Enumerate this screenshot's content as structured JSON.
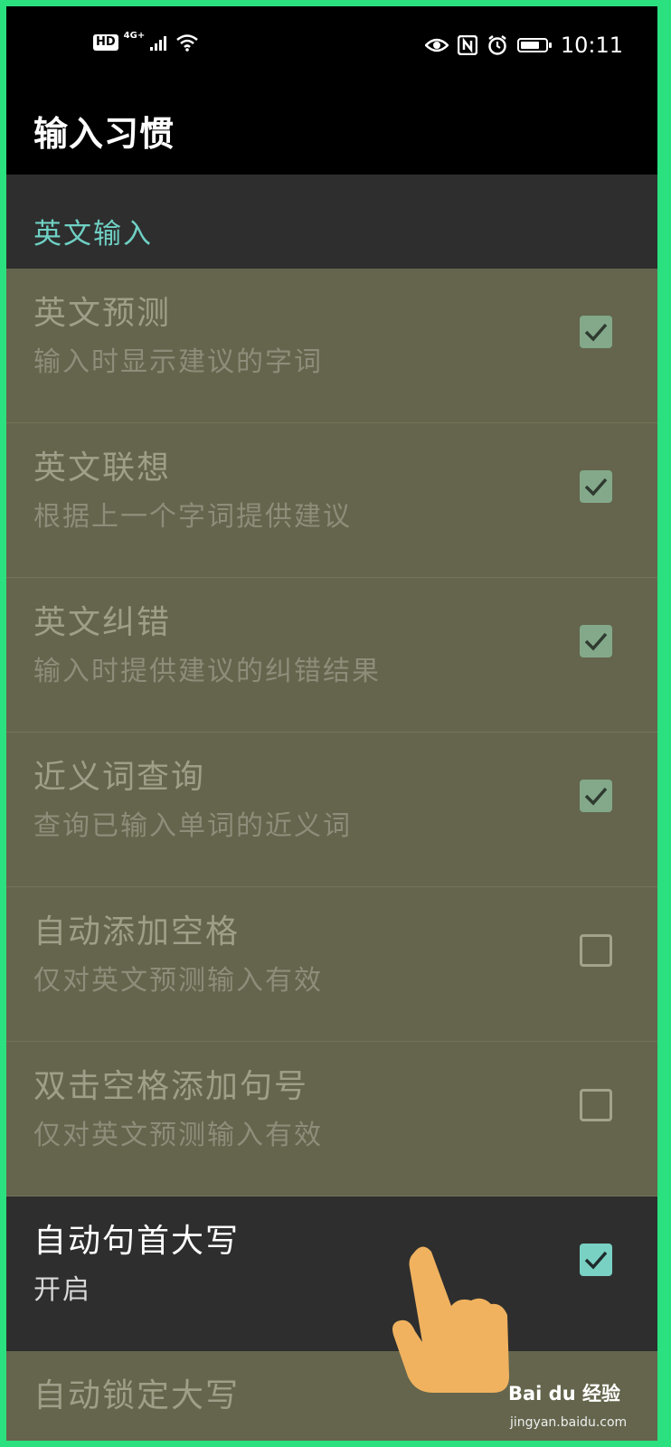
{
  "status_bar": {
    "left_badge": "HD",
    "network": "4G+",
    "time": "10:11",
    "icons": [
      "signal-icon",
      "wifi-icon",
      "eye-icon",
      "nfc-icon",
      "alarm-icon",
      "battery-icon"
    ]
  },
  "header": {
    "title": "输入习惯"
  },
  "section": {
    "label": "英文输入"
  },
  "items": [
    {
      "title": "英文预测",
      "subtitle": "输入时显示建议的字词",
      "checked": true,
      "dim": true
    },
    {
      "title": "英文联想",
      "subtitle": "根据上一个字词提供建议",
      "checked": true,
      "dim": true
    },
    {
      "title": "英文纠错",
      "subtitle": "输入时提供建议的纠错结果",
      "checked": true,
      "dim": true
    },
    {
      "title": "近义词查询",
      "subtitle": "查询已输入单词的近义词",
      "checked": true,
      "dim": true
    },
    {
      "title": "自动添加空格",
      "subtitle": "仅对英文预测输入有效",
      "checked": false,
      "dim": true
    },
    {
      "title": "双击空格添加句号",
      "subtitle": "仅对英文预测输入有效",
      "checked": false,
      "dim": true
    },
    {
      "title": "自动句首大写",
      "subtitle": "开启",
      "checked": true,
      "dim": false
    },
    {
      "title": "自动锁定大写",
      "subtitle": "",
      "checked": false,
      "dim": true
    }
  ],
  "watermark": {
    "brand": "Bai du 经验",
    "site": "jingyan.baidu.com"
  },
  "colors": {
    "accent": "#6fd0c4",
    "dim_overlay": "#64654c",
    "active_bg": "#2e2e2e",
    "frame": "#2be07e"
  }
}
